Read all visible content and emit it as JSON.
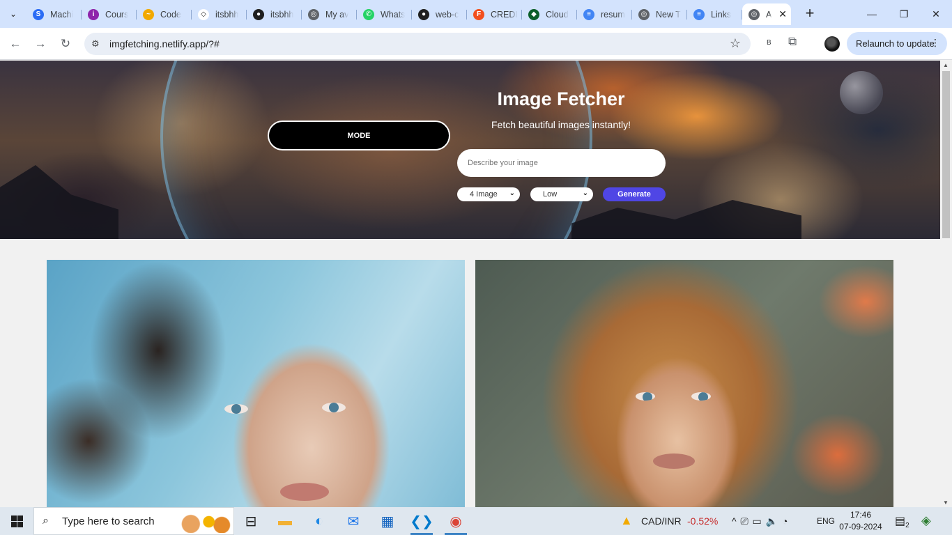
{
  "browser": {
    "tabs": [
      {
        "title": "Machi",
        "favicon_color": "#2b6cf5",
        "favicon_glyph": "S",
        "icon": "s-icon"
      },
      {
        "title": "Cours",
        "favicon_color": "#8e24aa",
        "favicon_glyph": "i",
        "icon": "course-icon"
      },
      {
        "title": "Code",
        "favicon_color": "#f2a900",
        "favicon_glyph": "~",
        "icon": "code-icon"
      },
      {
        "title": "itsbhh",
        "favicon_color": "#ffffff",
        "favicon_glyph": "◇",
        "icon": "codepen-icon"
      },
      {
        "title": "itsbhh",
        "favicon_color": "#1f1f1f",
        "favicon_glyph": "●",
        "icon": "github-icon"
      },
      {
        "title": "My av",
        "favicon_color": "#5f6368",
        "favicon_glyph": "◎",
        "icon": "globe-icon"
      },
      {
        "title": "Whats",
        "favicon_color": "#25d366",
        "favicon_glyph": "✆",
        "icon": "whatsapp-icon"
      },
      {
        "title": "web-c",
        "favicon_color": "#1f1f1f",
        "favicon_glyph": "●",
        "icon": "github-icon"
      },
      {
        "title": "CREDI",
        "favicon_color": "#f24e1e",
        "favicon_glyph": "F",
        "icon": "figma-icon"
      },
      {
        "title": "Cloud",
        "favicon_color": "#0b5f2a",
        "favicon_glyph": "◆",
        "icon": "mongodb-icon"
      },
      {
        "title": "resum",
        "favicon_color": "#4285f4",
        "favicon_glyph": "≡",
        "icon": "docs-icon"
      },
      {
        "title": "New T",
        "favicon_color": "#5f6368",
        "favicon_glyph": "◎",
        "icon": "chrome-icon"
      },
      {
        "title": "Links",
        "favicon_color": "#4285f4",
        "favicon_glyph": "≡",
        "icon": "docs-icon"
      }
    ],
    "active_tab": {
      "title": "A",
      "favicon_color": "#5f6368",
      "favicon_glyph": "◎",
      "icon": "globe-icon",
      "close": "✕"
    },
    "new_tab": "+",
    "controls": {
      "minimize": "—",
      "maximize": "❐",
      "close": "✕"
    },
    "tab_search": "⌄",
    "back": "←",
    "forward": "→",
    "reload": "↻",
    "url": "imgfetching.netlify.app/?#",
    "site_info": "⚙",
    "bookmark": "☆",
    "ext_badge": "B",
    "extensions": "⧉",
    "relaunch_label": "Relaunch to update",
    "menu": "⋮"
  },
  "page": {
    "title": "Image Fetcher",
    "subtitle": "Fetch beautiful images instantly!",
    "mode_button": "MODE",
    "prompt_placeholder": "Describe your image",
    "count_select": "4 Image",
    "quality_select": "Low",
    "generate_button": "Generate",
    "select_chevron": "⌄"
  },
  "scrollbar": {
    "up": "▲",
    "down": "▼"
  },
  "taskbar": {
    "search_placeholder": "Type here to search",
    "search_icon": "⌕",
    "apps": [
      {
        "name": "task-view",
        "glyph": "⊟",
        "color": "#1f1f1f",
        "open": false
      },
      {
        "name": "file-explorer",
        "glyph": "▬",
        "color": "#f2b134",
        "open": false
      },
      {
        "name": "edge",
        "glyph": "◐",
        "color": "#1e88e5",
        "open": false
      },
      {
        "name": "mail",
        "glyph": "✉",
        "color": "#1a73e8",
        "open": false
      },
      {
        "name": "store",
        "glyph": "▦",
        "color": "#1565c0",
        "open": false
      },
      {
        "name": "vscode",
        "glyph": "❮❯",
        "color": "#007acc",
        "open": true
      },
      {
        "name": "chrome",
        "glyph": "◉",
        "color": "#db4437",
        "open": true
      }
    ],
    "ticker_label": "CAD/INR",
    "ticker_value": "-0.52%",
    "ticker_value_color": "#c62828",
    "tray_language": "ENG",
    "tray_icons": "^  ⎚  ▭  🔈  ◔",
    "time": "17:46",
    "date": "07-09-2024",
    "notifications": "2"
  },
  "colors": {
    "accent": "#4f46e5",
    "mode_bg": "#000000"
  }
}
